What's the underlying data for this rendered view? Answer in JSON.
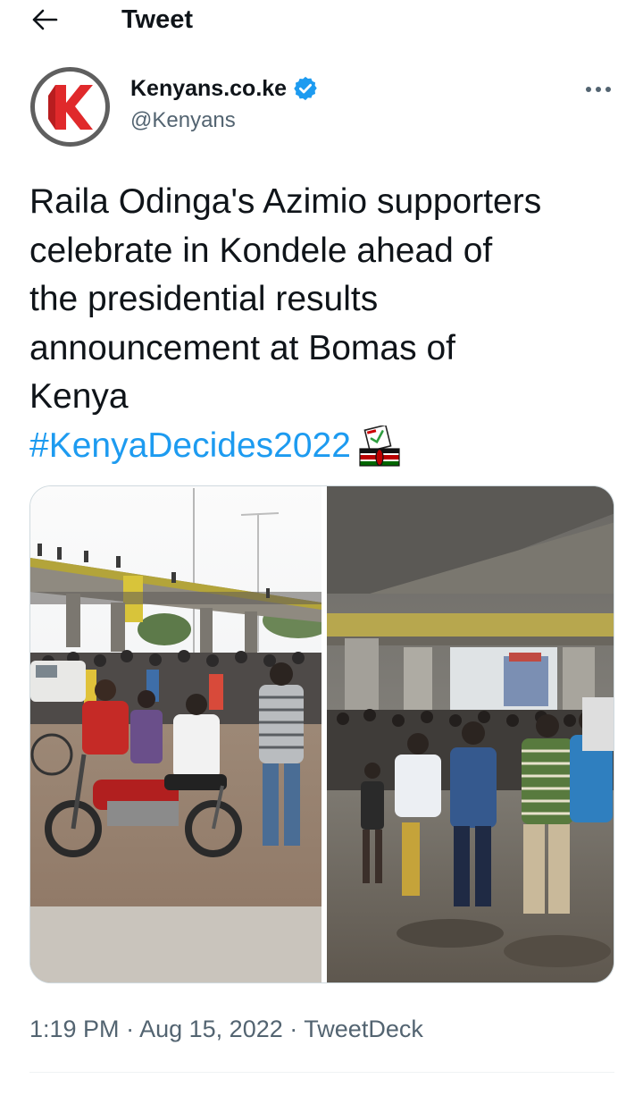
{
  "header": {
    "title": "Tweet"
  },
  "author": {
    "display_name": "Kenyans.co.ke",
    "handle": "@Kenyans",
    "verified": true,
    "avatar_letter": "K",
    "avatar_colors": {
      "ring": "#5f5f5f",
      "fill": "#e0292b",
      "bg": "#ffffff"
    }
  },
  "tweet": {
    "text_lines": [
      "Raila Odinga's Azimio supporters",
      "celebrate in Kondele ahead of",
      "the presidential results",
      "announcement at Bomas of",
      "Kenya"
    ],
    "hashtag": "#KenyaDecides2022",
    "hashtag_emoji": "ballot-box-kenya-flag-emoji"
  },
  "media": {
    "type": "photo-collage",
    "panels": [
      "left-photo",
      "right-photo"
    ]
  },
  "meta": {
    "time": "1:19 PM",
    "separator": "·",
    "date": "Aug 15, 2022",
    "source": "TweetDeck"
  },
  "colors": {
    "accent": "#1d9bf0",
    "text": "#0f1419",
    "secondary": "#536471",
    "divider": "#eff3f4"
  },
  "icons": {
    "back": "arrow-left-icon",
    "verified": "verified-badge-icon",
    "more": "more-dots-icon"
  }
}
